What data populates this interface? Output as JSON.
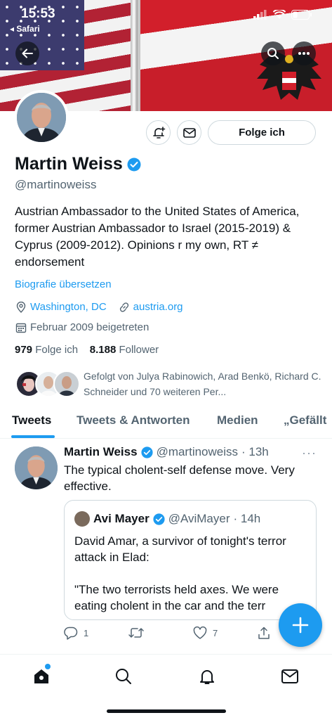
{
  "status_bar": {
    "time": "15:53",
    "back_app": "Safari"
  },
  "profile": {
    "name": "Martin Weiss",
    "handle": "@martinoweiss",
    "bio": "Austrian Ambassador to the United States of America, former Austrian Ambassador to Israel (2015-2019) & Cyprus (2009-2012). Opinions r my own, RT ≠ endorsement",
    "translate_label": "Biografie übersetzen",
    "location": "Washington, DC",
    "website": "austria.org",
    "joined": "Februar 2009 beigetreten",
    "following_count": "979",
    "following_label": "Folge ich",
    "followers_count": "8.188",
    "followers_label": "Follower",
    "followed_by": "Gefolgt von Julya Rabinowich, Arad Benkö, Richard C. Schneider und 70 weiteren Per...",
    "follow_button_label": "Folge ich"
  },
  "tabs": [
    "Tweets",
    "Tweets & Antworten",
    "Medien",
    "„Gefällt"
  ],
  "tweet": {
    "name": "Martin Weiss",
    "handle": "@martinoweiss",
    "time": "· 13h",
    "text": "The typical cholent-self defense move. Very effective.",
    "quote": {
      "name": "Avi Mayer",
      "handle": "@AviMayer",
      "time": "· 14h",
      "text": "David Amar, a survivor of tonight's terror attack in Elad:\n\n\"The two terrorists held axes. We were eating cholent in the car and the terr"
    },
    "reply_count": "1",
    "retweet_count": "",
    "like_count": "7"
  },
  "colors": {
    "accent": "#1d9bf0",
    "text": "#0f1419",
    "muted": "#536471",
    "border": "#cfd9de"
  },
  "icons": [
    "back-arrow-icon",
    "search-icon",
    "more-icon",
    "bell-plus-icon",
    "mail-icon",
    "verified-icon",
    "location-icon",
    "link-icon",
    "calendar-icon",
    "reply-icon",
    "retweet-icon",
    "like-icon",
    "share-icon",
    "compose-icon",
    "home-icon",
    "bell-icon"
  ]
}
